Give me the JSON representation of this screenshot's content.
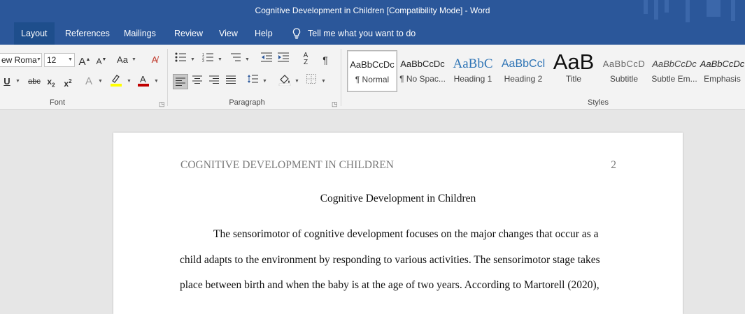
{
  "window": {
    "title": "Cognitive Development in Children [Compatibility Mode]  -  Word"
  },
  "menu": {
    "items": [
      "Layout",
      "References",
      "Mailings",
      "Review",
      "View",
      "Help"
    ],
    "tell_me": "Tell me what you want to do"
  },
  "font": {
    "family": "ew Roma",
    "size": "12",
    "group_label": "Font"
  },
  "paragraph": {
    "group_label": "Paragraph"
  },
  "styles": {
    "group_label": "Styles",
    "tiles": [
      {
        "sample": "AaBbCcDc",
        "name": "¶ Normal"
      },
      {
        "sample": "AaBbCcDc",
        "name": "¶ No Spac..."
      },
      {
        "sample": "AaBbC",
        "name": "Heading 1"
      },
      {
        "sample": "AaBbCcl",
        "name": "Heading 2"
      },
      {
        "sample": "AaB",
        "name": "Title"
      },
      {
        "sample": "AaBbCcD",
        "name": "Subtitle"
      },
      {
        "sample": "AaBbCcDc",
        "name": "Subtle Em..."
      },
      {
        "sample": "AaBbCcDc",
        "name": "Emphasis"
      }
    ]
  },
  "document": {
    "header_left": "COGNITIVE DEVELOPMENT IN CHILDREN",
    "page_number": "2",
    "title": "Cognitive Development in Children",
    "lines": [
      "The sensorimotor of cognitive development focuses on the major changes that occur as a",
      "child adapts to the environment by responding to various activities. The sensorimotor stage takes",
      "place between birth and when the baby is at the age of two years. According to Martorell (2020),"
    ]
  },
  "colors": {
    "title_bar": "#2b579a",
    "ribbon": "#f3f3f3",
    "canvas": "#e6e6e6",
    "highlight": "#ffff00",
    "font_color": "#c00000"
  }
}
